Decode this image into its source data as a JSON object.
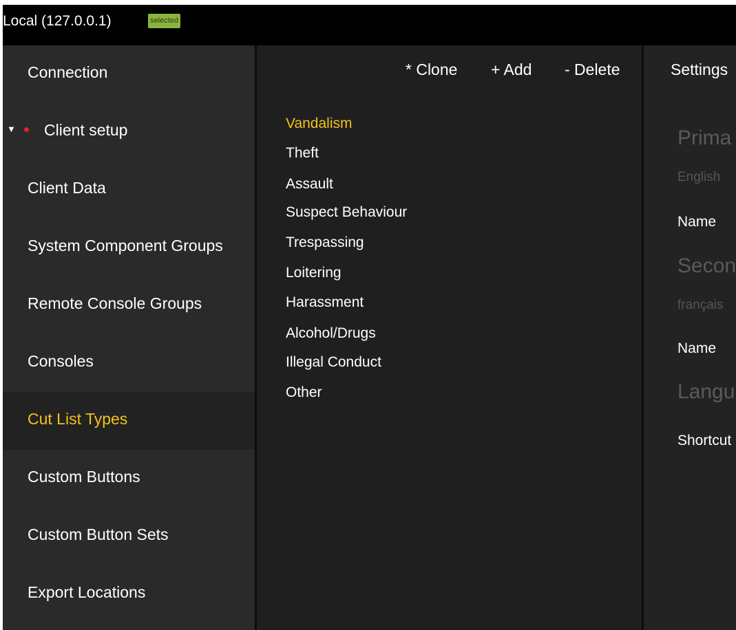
{
  "header": {
    "server": "Local (127.0.0.1)",
    "badge": "selected"
  },
  "sidebar": {
    "items": [
      {
        "label": "Connection"
      },
      {
        "label": "Client setup"
      },
      {
        "label": "Client Data"
      },
      {
        "label": "System Component Groups"
      },
      {
        "label": "Remote Console Groups"
      },
      {
        "label": "Consoles"
      },
      {
        "label": "Cut List Types"
      },
      {
        "label": "Custom Buttons"
      },
      {
        "label": "Custom Button Sets"
      },
      {
        "label": "Export Locations"
      }
    ]
  },
  "toolbar": {
    "clone": "* Clone",
    "add": "+ Add",
    "delete": "- Delete"
  },
  "cut_list_types": [
    "Vandalism",
    "Theft",
    "Assault",
    "Suspect Behaviour",
    "Trespassing",
    "Loitering",
    "Harassment",
    "Alcohol/Drugs",
    "Illegal Conduct",
    "Other"
  ],
  "settings": {
    "title": "Settings",
    "primary_heading": "Prima",
    "primary_language": "English",
    "primary_name_label": "Name",
    "secondary_heading": "Secon",
    "secondary_language": "français",
    "secondary_name_label": "Name",
    "language_heading": "Langu",
    "shortcut_label": "Shortcut"
  },
  "colors": {
    "accent": "#f2c21b",
    "badge": "#8ab43d",
    "status_dot": "#e2202c"
  }
}
